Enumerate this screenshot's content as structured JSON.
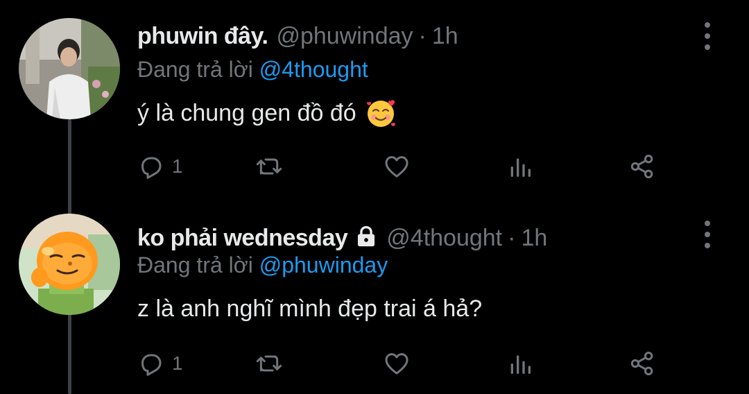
{
  "tweets": [
    {
      "display_name": "phuwin đây.",
      "handle": "@phuwinday",
      "separator": "·",
      "time": "1h",
      "reply_prefix": "Đang trả lời",
      "reply_to": "@4thought",
      "text": "ý là chung gen đồ đó",
      "emoji": "smiling-face-with-hearts",
      "reply_count": "1",
      "avatar": "person-photo-avatar"
    },
    {
      "display_name": "ko phải wednesday",
      "handle": "@4thought",
      "separator": "·",
      "time": "1h",
      "reply_prefix": "Đang trả lời",
      "reply_to": "@phuwinday",
      "text": "z là anh nghĩ mình đẹp trai á hả?",
      "protected": true,
      "reply_count": "1",
      "avatar": "cartoon-orange-avatar"
    }
  ],
  "colors": {
    "background": "#000000",
    "text": "#e7e9ea",
    "muted": "#71767b",
    "link": "#1d9bf0",
    "thread_line": "#3d4248"
  },
  "icons": [
    "reply-icon",
    "retweet-icon",
    "like-icon",
    "views-icon",
    "share-icon",
    "more-icon",
    "lock-icon"
  ]
}
